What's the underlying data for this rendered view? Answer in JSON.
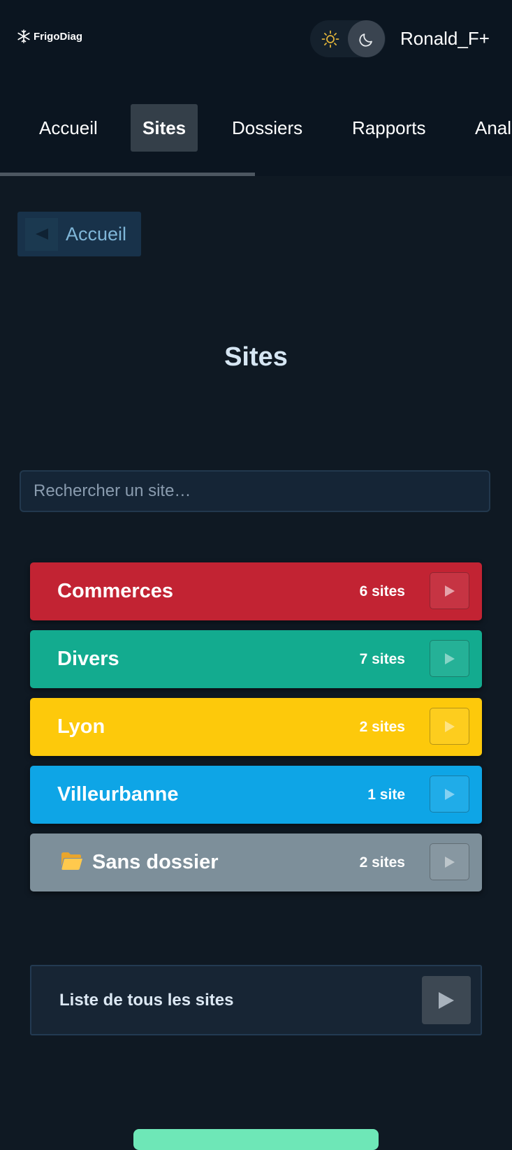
{
  "header": {
    "logo_text": "FrigoDiag",
    "username": "Ronald_F+",
    "theme_toggle": {
      "sun_icon": "sun-icon",
      "moon_icon": "moon-icon",
      "active": "dark"
    }
  },
  "nav": {
    "tabs": [
      {
        "label": "Accueil",
        "active": false
      },
      {
        "label": "Sites",
        "active": true
      },
      {
        "label": "Dossiers",
        "active": false
      },
      {
        "label": "Rapports",
        "active": false
      },
      {
        "label": "Anal",
        "active": false
      }
    ]
  },
  "back_button": {
    "label": "Accueil",
    "icon": "triangle-left-icon"
  },
  "page_title": "Sites",
  "search": {
    "placeholder": "Rechercher un site…",
    "value": ""
  },
  "folders": [
    {
      "name": "Commerces",
      "count": "6 sites",
      "color": "#c22333"
    },
    {
      "name": "Divers",
      "count": "7 sites",
      "color": "#13ab8f"
    },
    {
      "name": "Lyon",
      "count": "2 sites",
      "color": "#fdc90b"
    },
    {
      "name": "Villeurbanne",
      "count": "1 site",
      "color": "#0ea5e6"
    },
    {
      "name": "Sans dossier",
      "count": "2 sites",
      "color": "#7d8f9a",
      "icon": "folder-icon"
    }
  ],
  "all_sites": {
    "label": "Liste de tous les sites",
    "icon": "play-arrow-icon"
  },
  "bottom_button": {
    "color": "#6ee7b7"
  }
}
